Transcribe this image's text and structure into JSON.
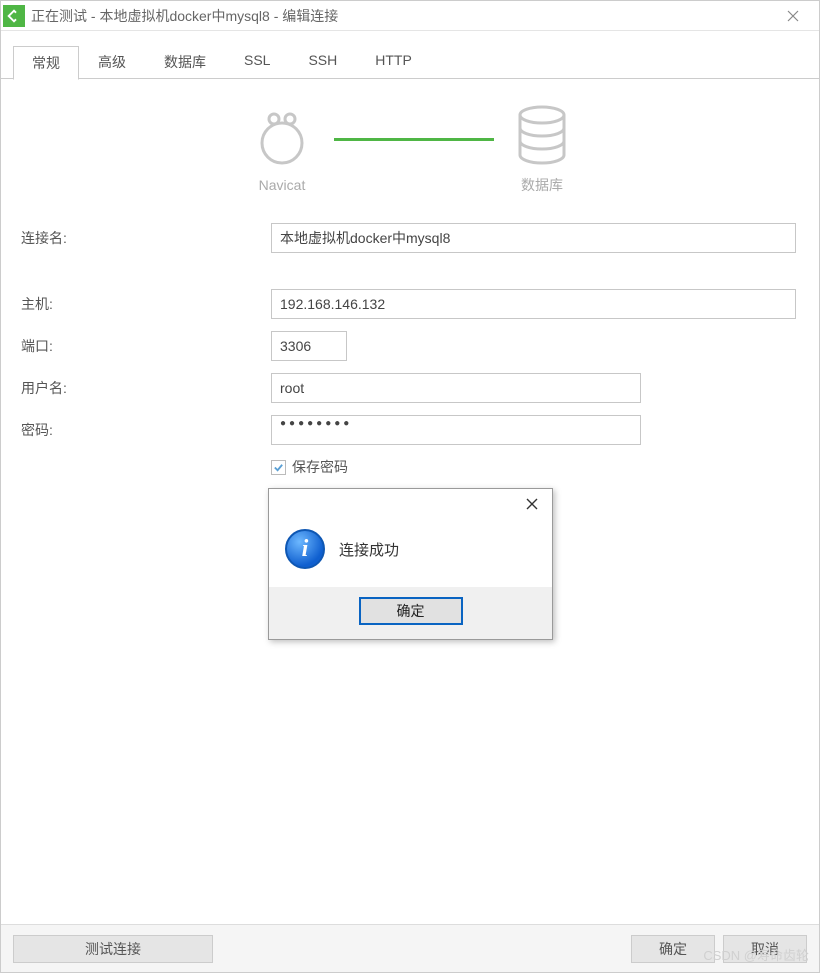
{
  "title": "正在测试 - 本地虚拟机docker中mysql8 - 编辑连接",
  "tabs": [
    {
      "label": "常规",
      "active": true
    },
    {
      "label": "高级",
      "active": false
    },
    {
      "label": "数据库",
      "active": false
    },
    {
      "label": "SSL",
      "active": false
    },
    {
      "label": "SSH",
      "active": false
    },
    {
      "label": "HTTP",
      "active": false
    }
  ],
  "diagram": {
    "left_label": "Navicat",
    "right_label": "数据库"
  },
  "form": {
    "connection_name_label": "连接名:",
    "connection_name_value": "本地虚拟机docker中mysql8",
    "host_label": "主机:",
    "host_value": "192.168.146.132",
    "port_label": "端口:",
    "port_value": "3306",
    "user_label": "用户名:",
    "user_value": "root",
    "password_label": "密码:",
    "password_mask": "●●●●●●●●",
    "save_password_label": "保存密码",
    "save_password_checked": true
  },
  "footer": {
    "test_label": "测试连接",
    "ok_label": "确定",
    "cancel_label": "取消"
  },
  "dialog": {
    "message": "连接成功",
    "ok_label": "确定"
  },
  "watermark": "CSDN @寿命齿轮"
}
